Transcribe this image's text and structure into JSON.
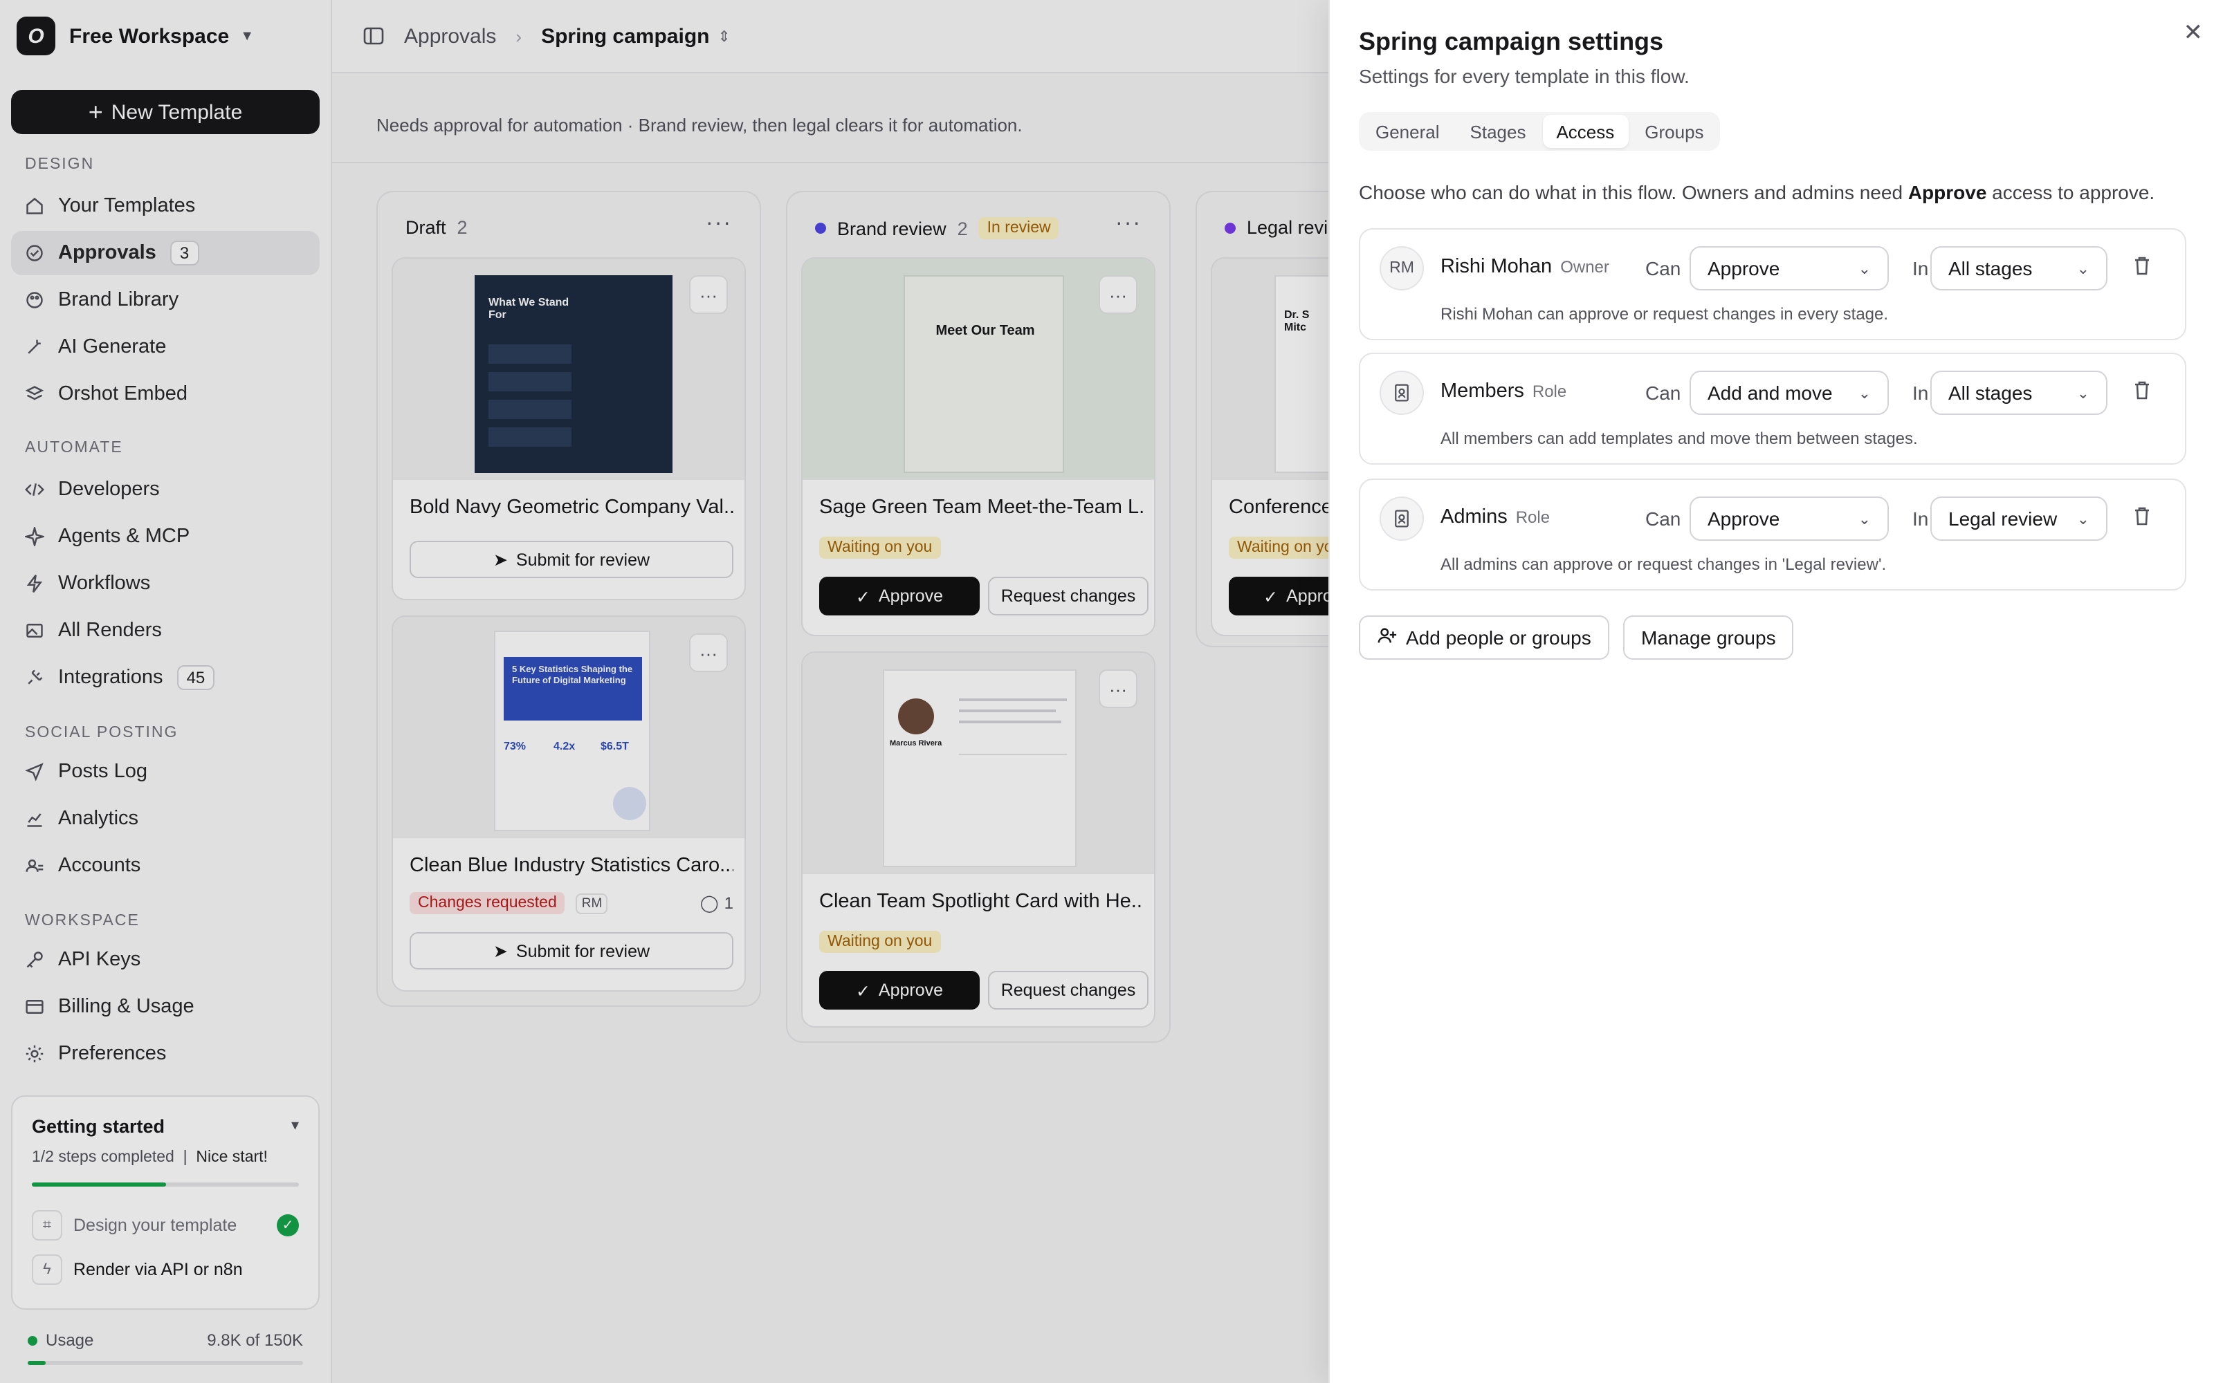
{
  "workspace": {
    "logo": "O",
    "name": "Free Workspace"
  },
  "sidebar": {
    "new_template": "New Template",
    "sections": {
      "design": "DESIGN",
      "automate": "AUTOMATE",
      "social": "SOCIAL POSTING",
      "workspace": "WORKSPACE"
    },
    "items": [
      {
        "label": "Your Templates",
        "icon": "home-icon"
      },
      {
        "label": "Approvals",
        "icon": "check-circle-icon",
        "badge": "3",
        "active": true
      },
      {
        "label": "Brand Library",
        "icon": "palette-icon"
      },
      {
        "label": "AI Generate",
        "icon": "wand-icon"
      },
      {
        "label": "Orshot Embed",
        "icon": "layers-icon"
      },
      {
        "label": "Developers",
        "icon": "code-icon"
      },
      {
        "label": "Agents & MCP",
        "icon": "sparkle-icon"
      },
      {
        "label": "Workflows",
        "icon": "bolt-icon"
      },
      {
        "label": "All Renders",
        "icon": "image-icon"
      },
      {
        "label": "Integrations",
        "icon": "plug-icon",
        "badge": "45"
      },
      {
        "label": "Posts Log",
        "icon": "send-icon"
      },
      {
        "label": "Analytics",
        "icon": "chart-icon"
      },
      {
        "label": "Accounts",
        "icon": "users-icon"
      },
      {
        "label": "API Keys",
        "icon": "key-icon"
      },
      {
        "label": "Billing & Usage",
        "icon": "card-icon"
      },
      {
        "label": "Preferences",
        "icon": "gear-icon"
      }
    ],
    "getting_started": {
      "title": "Getting started",
      "progress_text": "1/2 steps completed",
      "nice": "Nice start!",
      "progress": 0.5,
      "steps": [
        {
          "label": "Design your template",
          "done": true
        },
        {
          "label": "Render via API or n8n",
          "done": false
        }
      ]
    },
    "usage": {
      "label": "Usage",
      "value": "9.8K of 150K",
      "fraction": 0.065
    }
  },
  "header": {
    "crumb_root": "Approvals",
    "crumb_current": "Spring campaign"
  },
  "flow_description": "Needs approval for automation · Brand review, then legal clears it for automation.",
  "columns": [
    {
      "title": "Draft",
      "count": "2",
      "cards": [
        {
          "title": "Bold Navy Geometric Company Val...",
          "action": "Submit for review",
          "thumb_text": "What We Stand For"
        },
        {
          "title": "Clean Blue Industry Statistics Caro...",
          "status": "Changes requested",
          "initials": "RM",
          "comments": "1",
          "action": "Submit for review",
          "thumb_text": "5 Key Statistics Shaping the Future of Digital Marketing",
          "stats": [
            "73%",
            "4.2x",
            "$6.5T"
          ]
        }
      ]
    },
    {
      "title": "Brand review",
      "count": "2",
      "tag": "In review",
      "cards": [
        {
          "title": "Sage Green Team Meet-the-Team L...",
          "status": "Waiting on you",
          "approve": "Approve",
          "request": "Request changes",
          "thumb_text": "Meet Our Team"
        },
        {
          "title": "Clean Team Spotlight Card with He...",
          "status": "Waiting on you",
          "approve": "Approve",
          "request": "Request changes",
          "thumb_text": "Marcus Rivera"
        }
      ]
    },
    {
      "title": "Legal revie",
      "cards": [
        {
          "title": "Conference",
          "status": "Waiting on yo",
          "approve": "Appro",
          "thumb_text": "Dr. S Mitc"
        }
      ]
    }
  ],
  "panel": {
    "title": "Spring campaign settings",
    "subtitle": "Settings for every template in this flow.",
    "tabs": [
      "General",
      "Stages",
      "Access",
      "Groups"
    ],
    "active_tab": "Access",
    "desc_pre": "Choose who can do what in this flow. Owners and admins need ",
    "desc_bold": "Approve",
    "desc_post": " access to approve.",
    "can_label": "Can",
    "in_label": "In",
    "entries": [
      {
        "avatar": "RM",
        "name": "Rishi Mohan",
        "role": "Owner",
        "permission": "Approve",
        "scope": "All stages",
        "note": "Rishi Mohan can approve or request changes in every stage."
      },
      {
        "avatar": "",
        "name": "Members",
        "role": "Role",
        "permission": "Add and move",
        "scope": "All stages",
        "note": "All members can add templates and move them between stages."
      },
      {
        "avatar": "",
        "name": "Admins",
        "role": "Role",
        "permission": "Approve",
        "scope": "Legal review",
        "note": "All admins can approve or request changes in 'Legal review'."
      }
    ],
    "add_people": "Add people or groups",
    "manage_groups": "Manage groups"
  }
}
